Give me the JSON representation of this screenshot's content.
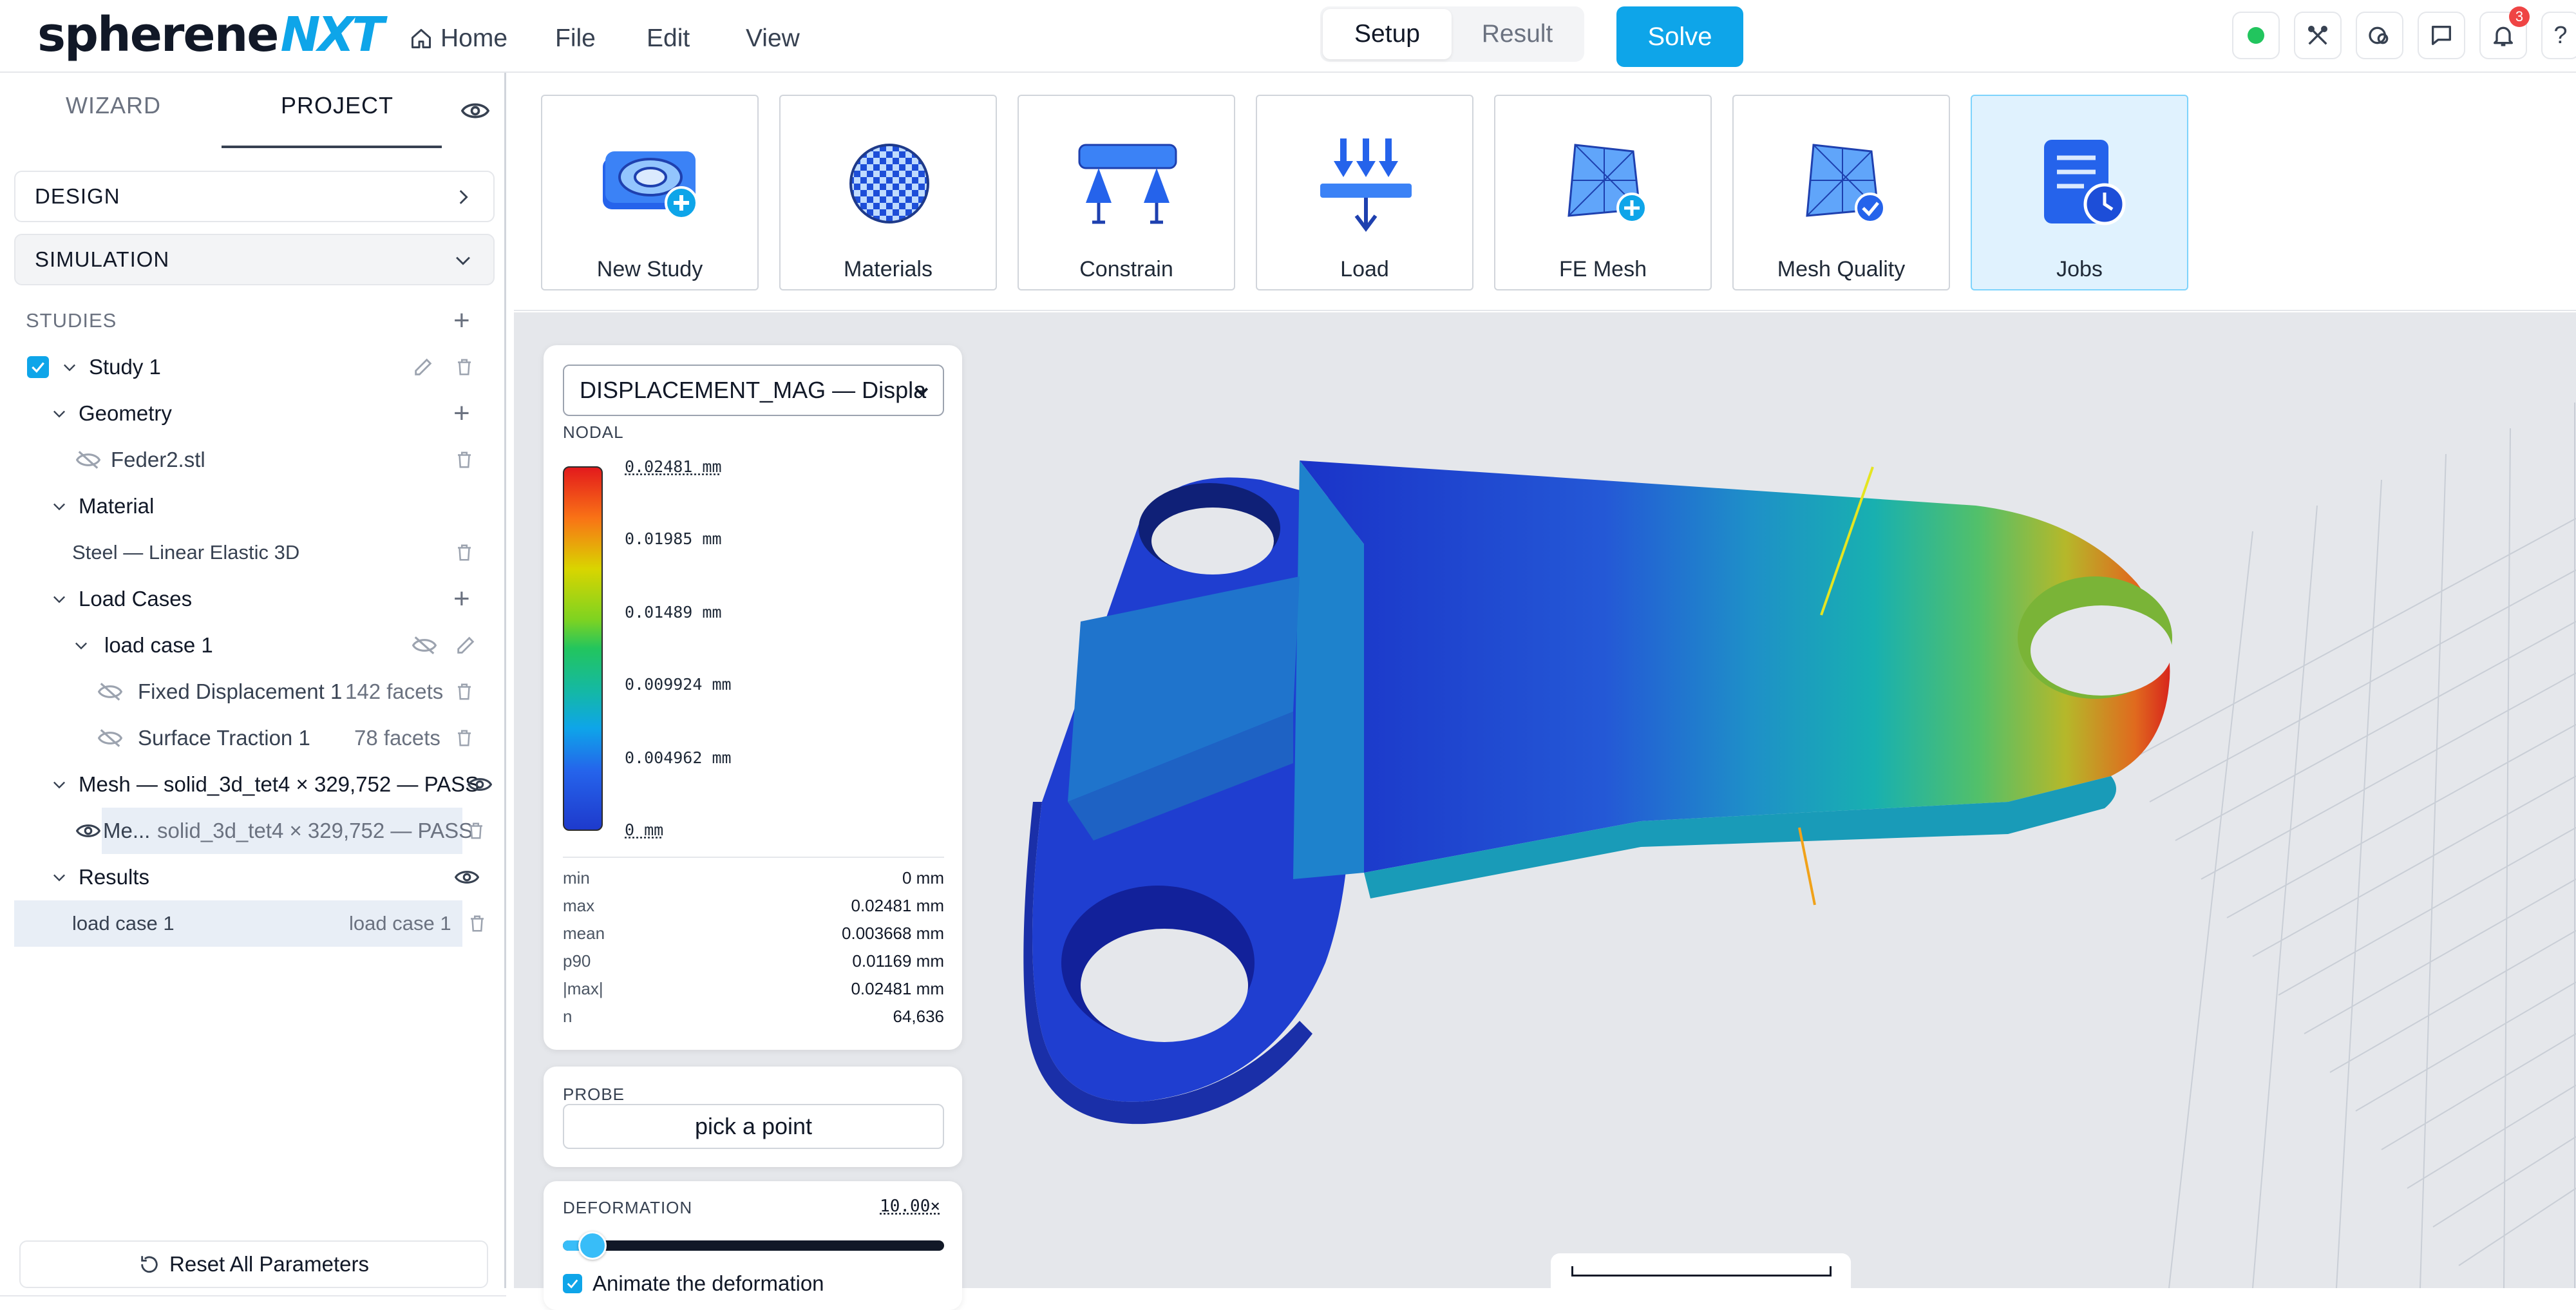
{
  "app": {
    "logo_main": "spherene",
    "logo_accent": "NXT"
  },
  "topbar": {
    "menu": [
      {
        "label": "Home",
        "icon": "home-icon"
      },
      {
        "label": "File"
      },
      {
        "label": "Edit"
      },
      {
        "label": "View"
      }
    ],
    "mode_tabs": [
      "Setup",
      "Result"
    ],
    "active_mode": "Setup",
    "solve_label": "Solve",
    "status_color": "#22c55e",
    "notification_count": "3",
    "help_label": "?",
    "icons": [
      "status-icon",
      "tools-icon",
      "account-icon",
      "chat-icon",
      "bell-icon",
      "help-icon"
    ]
  },
  "leftpanel": {
    "tabs": [
      "WIZARD",
      "PROJECT"
    ],
    "active_tab": "PROJECT",
    "design_label": "DESIGN",
    "simulation_label": "SIMULATION",
    "studies_label": "STUDIES",
    "tree": {
      "study": "Study 1",
      "geometry": "Geometry",
      "geometry_file": "Feder2.stl",
      "material": "Material",
      "material_value": "Steel — Linear Elastic 3D",
      "load_cases": "Load Cases",
      "load_case": "load case 1",
      "bc1_name": "Fixed Displacement 1",
      "bc1_count": "142 facets",
      "bc2_name": "Surface Traction 1",
      "bc2_count": "78 facets",
      "mesh": "Mesh — solid_3d_tet4 × 329,752 — PASS",
      "mesh_item_name": "Me...",
      "mesh_item_detail": "solid_3d_tet4 × 329,752 — PASS",
      "results": "Results",
      "result_item": "load case 1",
      "result_item_detail": "load case 1"
    },
    "reset_label": "Reset All Parameters"
  },
  "ribbon": {
    "tools": [
      {
        "label": "New Study",
        "icon": "new-study-icon"
      },
      {
        "label": "Materials",
        "icon": "materials-icon"
      },
      {
        "label": "Constrain",
        "icon": "constrain-icon"
      },
      {
        "label": "Load",
        "icon": "load-icon"
      },
      {
        "label": "FE Mesh",
        "icon": "fe-mesh-icon"
      },
      {
        "label": "Mesh Quality",
        "icon": "mesh-quality-icon"
      },
      {
        "label": "Jobs",
        "icon": "jobs-icon"
      }
    ],
    "active_tool": "Jobs"
  },
  "result_panel": {
    "field_select": "DISPLACEMENT_MAG — Displa",
    "location_label": "NODAL",
    "colorbar_labels": [
      "0.02481 mm",
      "0.01985 mm",
      "0.01489 mm",
      "0.009924 mm",
      "0.004962 mm",
      "0 mm"
    ],
    "stats": [
      {
        "key": "min",
        "value": "0 mm"
      },
      {
        "key": "max",
        "value": "0.02481 mm"
      },
      {
        "key": "mean",
        "value": "0.003668 mm"
      },
      {
        "key": "p90",
        "value": "0.01169 mm"
      },
      {
        "key": "|max|",
        "value": "0.02481 mm"
      },
      {
        "key": "n",
        "value": "64,636"
      }
    ],
    "probe_label": "PROBE",
    "probe_button": "pick a point",
    "deformation_label": "DEFORMATION",
    "deformation_value": "10.00×",
    "deformation_fraction": 0.04,
    "animate_label": "Animate the deformation"
  }
}
